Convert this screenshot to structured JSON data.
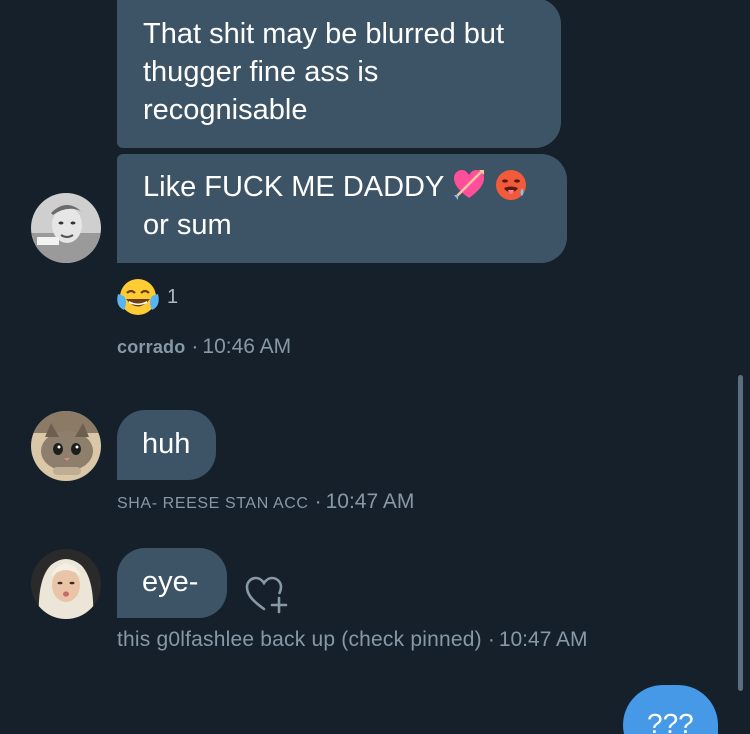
{
  "colors": {
    "background": "#15202b",
    "received_bubble": "#3d5466",
    "sent_bubble": "#4599e6",
    "meta_text": "#8899a6"
  },
  "messages": {
    "first": {
      "text": "That shit may be blurred but thugger fine ass is recognisable"
    },
    "second": {
      "text_line1": "Like FUCK ME DADDY",
      "text_line2": "or sum",
      "emojis": [
        "heart-with-arrow-icon",
        "hot-face-icon"
      ]
    },
    "reaction": {
      "emoji": "face-with-tears-of-joy-icon",
      "count": "1"
    },
    "corrado_meta": {
      "sender": "corrado",
      "dot": "·",
      "time": "10:46 AM"
    },
    "huh": {
      "text": "huh",
      "sender": "SHA- REESE STAN ACC",
      "dot": "·",
      "time": "10:47 AM"
    },
    "eye": {
      "text": "eye-",
      "sender": "this g0lfashlee back up (check pinned)",
      "dot": "·",
      "time": "10:47 AM"
    },
    "mine": {
      "text": "???"
    }
  }
}
